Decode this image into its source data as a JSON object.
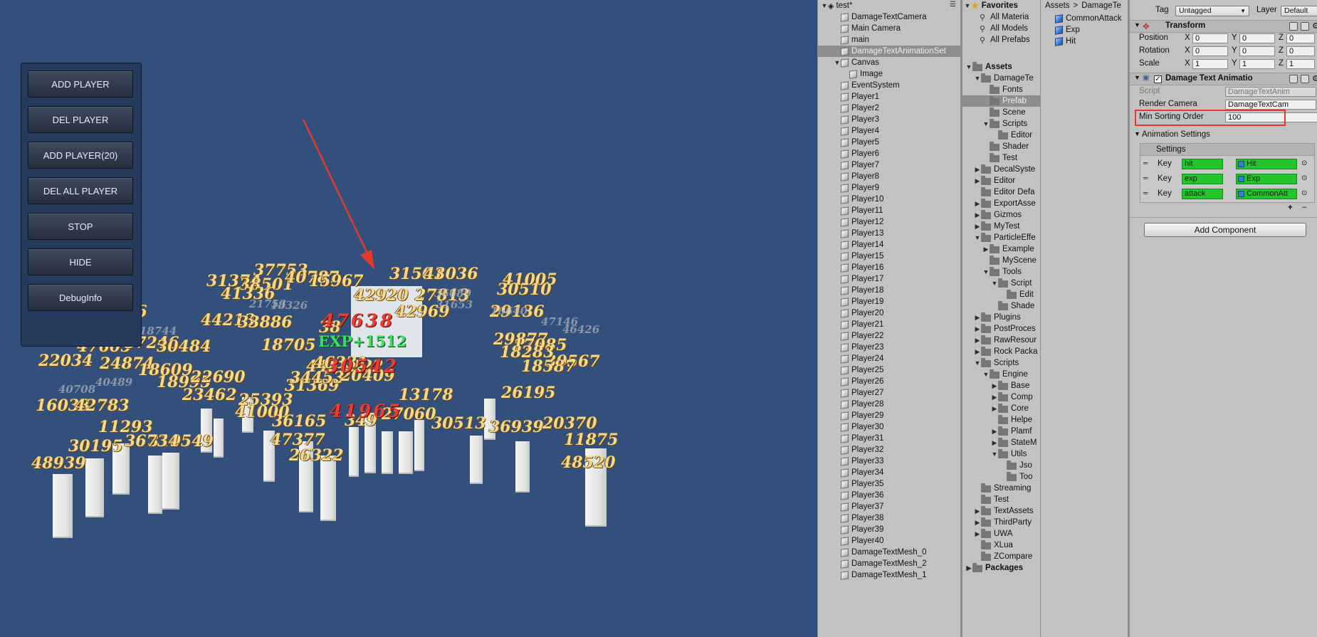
{
  "game": {
    "buttons": [
      "ADD PLAYER",
      "DEL PLAYER",
      "ADD PLAYER(20)",
      "DEL ALL PLAYER",
      "STOP",
      "HIDE",
      "DebugInfo"
    ],
    "exp_text": "EXP+1512",
    "red_texts": [
      "47638",
      "30542",
      "41965"
    ],
    "damage_numbers": [
      "37753",
      "31501",
      "43036",
      "41005",
      "31374",
      "38501",
      "40787",
      "15967",
      "30510",
      "41336",
      "42920",
      "27813",
      "42969",
      "29136",
      "13686",
      "44213",
      "33886",
      "38",
      "22034",
      "47605",
      "37246",
      "30484",
      "18705",
      "29877",
      "17085",
      "24874",
      "30567",
      "44212",
      "22",
      "18283",
      "18609",
      "18995",
      "46331",
      "22690",
      "18587",
      "31369",
      "34453",
      "23462",
      "20409",
      "26195",
      "13178",
      "16033",
      "42783",
      "25393",
      "30513",
      "11293",
      "36939",
      "20370",
      "310549",
      "30195",
      "36734",
      "41000",
      "47377",
      "26322",
      "11875",
      "48939",
      "48520",
      "36165",
      "349",
      "27060"
    ],
    "faint_numbers": [
      "18744",
      "40708",
      "40489",
      "16640",
      "21753",
      "18326",
      "47146",
      "31653",
      "36689",
      "46426"
    ]
  },
  "hierarchy": {
    "scene": "test*",
    "items": [
      {
        "label": "DamageTextCamera",
        "indent": 1
      },
      {
        "label": "Main Camera",
        "indent": 1
      },
      {
        "label": "main",
        "indent": 1
      },
      {
        "label": "DamageTextAnimationSet",
        "indent": 1,
        "selected": true
      },
      {
        "label": "Canvas",
        "indent": 1,
        "expanded": true
      },
      {
        "label": "Image",
        "indent": 2
      },
      {
        "label": "EventSystem",
        "indent": 1
      },
      {
        "label": "Player1",
        "indent": 1
      },
      {
        "label": "Player2",
        "indent": 1
      },
      {
        "label": "Player3",
        "indent": 1
      },
      {
        "label": "Player4",
        "indent": 1
      },
      {
        "label": "Player5",
        "indent": 1
      },
      {
        "label": "Player6",
        "indent": 1
      },
      {
        "label": "Player7",
        "indent": 1
      },
      {
        "label": "Player8",
        "indent": 1
      },
      {
        "label": "Player9",
        "indent": 1
      },
      {
        "label": "Player10",
        "indent": 1
      },
      {
        "label": "Player11",
        "indent": 1
      },
      {
        "label": "Player12",
        "indent": 1
      },
      {
        "label": "Player13",
        "indent": 1
      },
      {
        "label": "Player14",
        "indent": 1
      },
      {
        "label": "Player15",
        "indent": 1
      },
      {
        "label": "Player16",
        "indent": 1
      },
      {
        "label": "Player17",
        "indent": 1
      },
      {
        "label": "Player18",
        "indent": 1
      },
      {
        "label": "Player19",
        "indent": 1
      },
      {
        "label": "Player20",
        "indent": 1
      },
      {
        "label": "Player21",
        "indent": 1
      },
      {
        "label": "Player22",
        "indent": 1
      },
      {
        "label": "Player23",
        "indent": 1
      },
      {
        "label": "Player24",
        "indent": 1
      },
      {
        "label": "Player25",
        "indent": 1
      },
      {
        "label": "Player26",
        "indent": 1
      },
      {
        "label": "Player27",
        "indent": 1
      },
      {
        "label": "Player28",
        "indent": 1
      },
      {
        "label": "Player29",
        "indent": 1
      },
      {
        "label": "Player30",
        "indent": 1
      },
      {
        "label": "Player31",
        "indent": 1
      },
      {
        "label": "Player32",
        "indent": 1
      },
      {
        "label": "Player33",
        "indent": 1
      },
      {
        "label": "Player34",
        "indent": 1
      },
      {
        "label": "Player35",
        "indent": 1
      },
      {
        "label": "Player36",
        "indent": 1
      },
      {
        "label": "Player37",
        "indent": 1
      },
      {
        "label": "Player38",
        "indent": 1
      },
      {
        "label": "Player39",
        "indent": 1
      },
      {
        "label": "Player40",
        "indent": 1
      },
      {
        "label": "DamageTextMesh_0",
        "indent": 1
      },
      {
        "label": "DamageTextMesh_2",
        "indent": 1
      },
      {
        "label": "DamageTextMesh_1",
        "indent": 1
      }
    ]
  },
  "project": {
    "favorites_label": "Favorites",
    "favorites": [
      "All Materia",
      "All Models",
      "All Prefabs"
    ],
    "tree": [
      {
        "label": "Assets",
        "indent": 0,
        "arrow": "down",
        "bold": true
      },
      {
        "label": "DamageTe",
        "indent": 1,
        "arrow": "down"
      },
      {
        "label": "Fonts",
        "indent": 2
      },
      {
        "label": "Prefab",
        "indent": 2,
        "selected": true
      },
      {
        "label": "Scene",
        "indent": 2
      },
      {
        "label": "Scripts",
        "indent": 2,
        "arrow": "down"
      },
      {
        "label": "Editor",
        "indent": 3
      },
      {
        "label": "Shader",
        "indent": 2
      },
      {
        "label": "Test",
        "indent": 2
      },
      {
        "label": "DecalSyste",
        "indent": 1,
        "arrow": "right"
      },
      {
        "label": "Editor",
        "indent": 1,
        "arrow": "right"
      },
      {
        "label": "Editor Defa",
        "indent": 1
      },
      {
        "label": "ExportAsse",
        "indent": 1,
        "arrow": "right"
      },
      {
        "label": "Gizmos",
        "indent": 1,
        "arrow": "right"
      },
      {
        "label": "MyTest",
        "indent": 1,
        "arrow": "right"
      },
      {
        "label": "ParticleEffe",
        "indent": 1,
        "arrow": "down"
      },
      {
        "label": "Example",
        "indent": 2,
        "arrow": "right"
      },
      {
        "label": "MyScene",
        "indent": 2
      },
      {
        "label": "Tools",
        "indent": 2,
        "arrow": "down"
      },
      {
        "label": "Script",
        "indent": 3,
        "arrow": "down"
      },
      {
        "label": "Edit",
        "indent": 4
      },
      {
        "label": "Shade",
        "indent": 3
      },
      {
        "label": "Plugins",
        "indent": 1,
        "arrow": "right"
      },
      {
        "label": "PostProces",
        "indent": 1,
        "arrow": "right"
      },
      {
        "label": "RawResour",
        "indent": 1,
        "arrow": "right"
      },
      {
        "label": "Rock Packa",
        "indent": 1,
        "arrow": "right"
      },
      {
        "label": "Scripts",
        "indent": 1,
        "arrow": "down"
      },
      {
        "label": "Engine",
        "indent": 2,
        "arrow": "down"
      },
      {
        "label": "Base",
        "indent": 3,
        "arrow": "right"
      },
      {
        "label": "Comp",
        "indent": 3,
        "arrow": "right"
      },
      {
        "label": "Core",
        "indent": 3,
        "arrow": "right"
      },
      {
        "label": "Helpe",
        "indent": 3
      },
      {
        "label": "Plamf",
        "indent": 3,
        "arrow": "right"
      },
      {
        "label": "StateM",
        "indent": 3,
        "arrow": "right"
      },
      {
        "label": "Utils",
        "indent": 3,
        "arrow": "down"
      },
      {
        "label": "Jso",
        "indent": 4
      },
      {
        "label": "Too",
        "indent": 4
      },
      {
        "label": "Streaming",
        "indent": 1
      },
      {
        "label": "Test",
        "indent": 1
      },
      {
        "label": "TextAssets",
        "indent": 1,
        "arrow": "right"
      },
      {
        "label": "ThirdParty",
        "indent": 1,
        "arrow": "right"
      },
      {
        "label": "UWA",
        "indent": 1,
        "arrow": "right"
      },
      {
        "label": "XLua",
        "indent": 1
      },
      {
        "label": "ZCompare",
        "indent": 1
      },
      {
        "label": "Packages",
        "indent": 0,
        "arrow": "right",
        "bold": true
      }
    ]
  },
  "assets_col": {
    "breadcrumb_root": "Assets",
    "breadcrumb_sep": ">",
    "breadcrumb_current": "DamageTe",
    "items": [
      "CommonAttack",
      "Exp",
      "Hit"
    ]
  },
  "inspector": {
    "tag_label": "Tag",
    "tag_value": "Untagged",
    "layer_label": "Layer",
    "layer_value": "Default",
    "transform_title": "Transform",
    "position_label": "Position",
    "rotation_label": "Rotation",
    "scale_label": "Scale",
    "axis_x": "X",
    "axis_y": "Y",
    "axis_z": "Z",
    "position": [
      "0",
      "0",
      "0"
    ],
    "rotation": [
      "0",
      "0",
      "0"
    ],
    "scale": [
      "1",
      "1",
      "1"
    ],
    "component_title": "Damage Text Animatio",
    "script_label": "Script",
    "script_value": "DamageTextAnim",
    "render_camera_label": "Render Camera",
    "render_camera_value": "DamageTextCam",
    "min_sorting_label": "Min Sorting Order",
    "min_sorting_value": "100",
    "animation_settings_label": "Animation Settings",
    "settings_label": "Settings",
    "key_label": "Key",
    "keys": [
      {
        "key": "hit",
        "value": "Hit"
      },
      {
        "key": "exp",
        "value": "Exp"
      },
      {
        "key": "attack",
        "value": "CommonAtt"
      }
    ],
    "plus": "+",
    "minus": "−",
    "add_component": "Add Component"
  },
  "colors": {
    "game_bg": "#334f7b",
    "highlight": "#e23b2e",
    "green_field": "#22c62a",
    "damage_gold": "#f6d88a"
  }
}
